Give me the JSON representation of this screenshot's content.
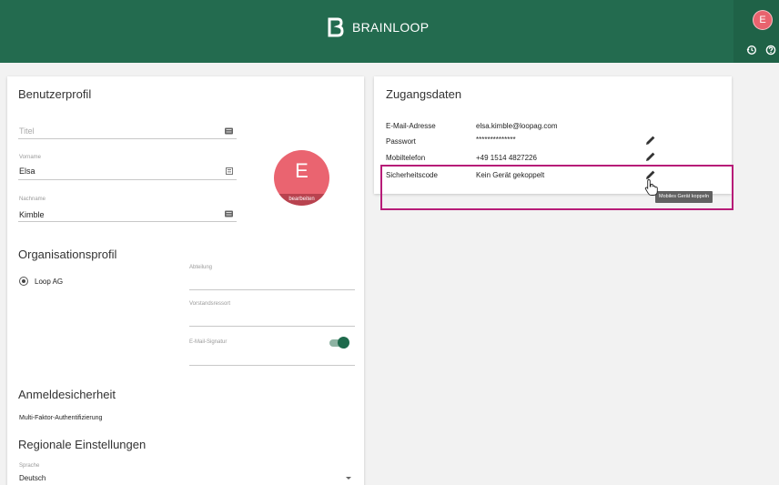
{
  "header": {
    "brand": "BRAINLOOP",
    "user_initial": "E"
  },
  "profile": {
    "title": "Benutzerprofil",
    "fields": {
      "titel": {
        "placeholder": "Titel"
      },
      "vorname": {
        "label": "Vorname",
        "value": "Elsa"
      },
      "nachname": {
        "label": "Nachname",
        "value": "Kimble"
      }
    },
    "avatar": {
      "initial": "E",
      "edit_label": "bearbeiten"
    }
  },
  "organisation": {
    "title": "Organisationsprofil",
    "org_name": "Loop AG",
    "fields": {
      "abteilung": "Abteilung",
      "vorstandsressort": "Vorstandsressort",
      "email_signatur": "E-Mail-Signatur"
    }
  },
  "security": {
    "title": "Anmeldesicherheit",
    "mfa_label": "Multi-Faktor-Authentifizierung",
    "mfa_enabled": true
  },
  "regional": {
    "title": "Regionale Einstellungen",
    "language_label": "Sprache",
    "language_value": "Deutsch"
  },
  "access": {
    "title": "Zugangsdaten",
    "rows": [
      {
        "label": "E-Mail-Adresse",
        "value": "elsa.kimble@loopag.com"
      },
      {
        "label": "Passwort",
        "value": "**************"
      },
      {
        "label": "Mobiltelefon",
        "value": "+49 1514 4827226"
      },
      {
        "label": "Sicherheitscode",
        "value": "Kein Gerät gekoppelt"
      }
    ],
    "tooltip": "Mobiles Gerät koppeln"
  },
  "colors": {
    "header_bg": "#236b4f",
    "avatar": "#ea6470",
    "toggle_on": "#1e6a4c",
    "highlight": "#b71c78"
  }
}
